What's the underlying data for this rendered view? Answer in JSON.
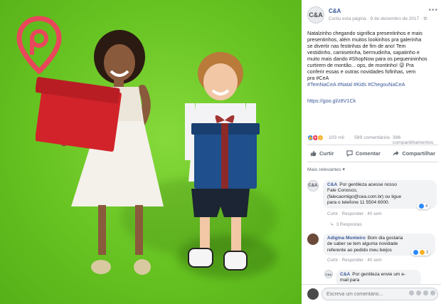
{
  "photo": {
    "background": "#6fcb2a",
    "logo_color": "#e8475b",
    "girl_box_color": "#d2232a",
    "boy_box_color": "#1f4f8c"
  },
  "post": {
    "page_name": "C&A",
    "avatar_text": "C&A",
    "meta": "Curtiu esta página · 9 de dezembro de 2017 · ⚙",
    "text_lines": [
      "Natalzinho chegando significa presentinhos e mais",
      "presentinhos, além muitos lookinhos pra galerinha",
      "se divertir nas festinhas de fim de ano! Tem",
      "vestidinho, camisetinha, bermudinha, sapatinho e",
      "muito mais dando #ShopNow para os pequenininhos",
      "curtirem de montão... ops, de montinho! 😜 Pra",
      "conferir essas e outras novidades fofinhas, vem",
      "pra #CeA"
    ],
    "hashtags": "#TemNaCeA #Natal #Kids #ChegouNaCeA",
    "link": "https://goo.gl/z8V1Ck"
  },
  "stats": {
    "reactions": "103 mil",
    "comments": "589 comentários",
    "shares": "396 compartilhamentos"
  },
  "actions": {
    "like": "Curtir",
    "comment": "Comentar",
    "share": "Compartilhar"
  },
  "relevance": "Mais relevantes ▾",
  "comments": [
    {
      "author": "C&A",
      "avatar_text": "C&A",
      "lines": [
        "Por gentileza acesse nosso",
        "Fale Conosco,",
        "(falecaomigo@cea.com.br) ou ligue",
        "para o telefone 11 5504 6000."
      ],
      "links": "Curtir · Responder · 40 sem",
      "react_count": "4",
      "replies": "3 Respostas"
    },
    {
      "author": "Adigina Monteiro",
      "lines": [
        "Bom dia gostaria",
        "de saber se tem alguma novidade",
        "referente ao pedido meu beijos"
      ],
      "links": "Curtir · Responder · 40 sem",
      "react_count": "3"
    },
    {
      "author": "C&A",
      "avatar_text": "C&A",
      "lines": [
        "Por gentileza envie um e-",
        "mail para"
      ]
    }
  ],
  "composer": {
    "placeholder": "Escreva um comentário..."
  }
}
